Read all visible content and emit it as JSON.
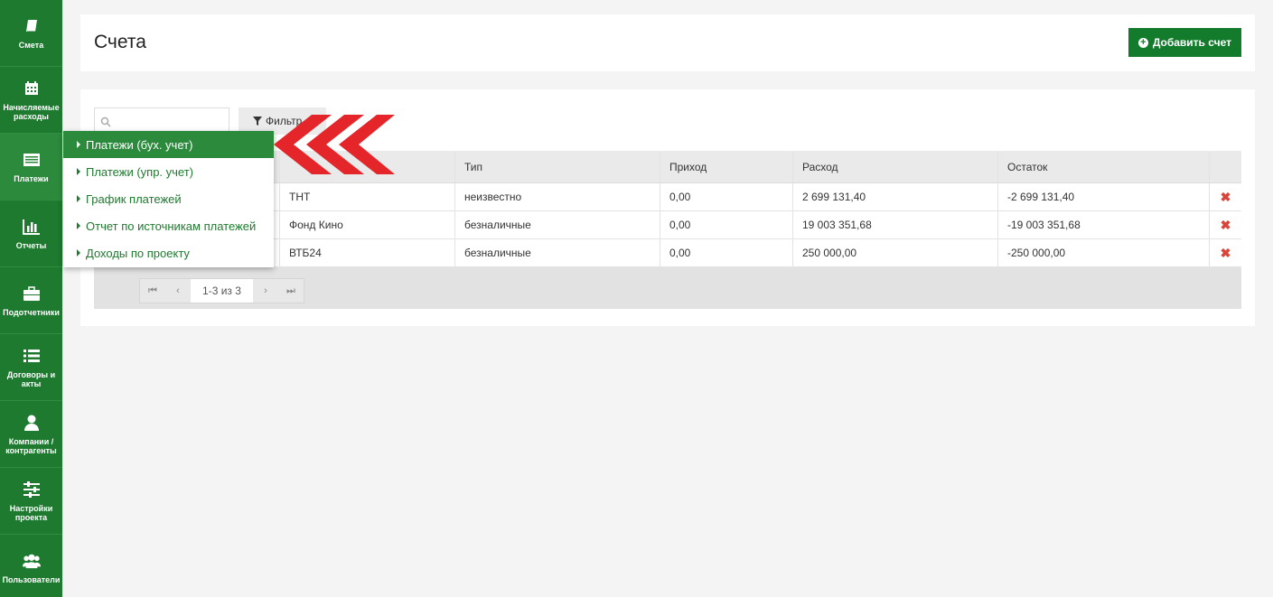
{
  "sidebar": {
    "items": [
      {
        "label": "Смета",
        "icon": "book-icon"
      },
      {
        "label": "Начисляемые расходы",
        "icon": "calendar-icon"
      },
      {
        "label": "Платежи",
        "icon": "list-card-icon"
      },
      {
        "label": "Отчеты",
        "icon": "bar-chart-icon"
      },
      {
        "label": "Подотчетники",
        "icon": "briefcase-icon"
      },
      {
        "label": "Договоры и акты",
        "icon": "list-icon"
      },
      {
        "label": "Компании / контрагенты",
        "icon": "user-icon"
      },
      {
        "label": "Настройки проекта",
        "icon": "sliders-icon"
      },
      {
        "label": "Пользователи",
        "icon": "users-icon"
      }
    ]
  },
  "header": {
    "title": "Счета",
    "add_button": "Добавить счет"
  },
  "toolbar": {
    "search_placeholder": "",
    "filter_label": "Фильтр"
  },
  "table": {
    "columns": [
      "",
      "",
      "Тип",
      "Приход",
      "Расход",
      "Остаток",
      ""
    ],
    "rows": [
      {
        "name": "ТНТ",
        "type": "неизвестно",
        "income": "0,00",
        "expense": "2 699 131,40",
        "balance": "-2 699 131,40"
      },
      {
        "name": "Фонд Кино",
        "type": "безналичные",
        "income": "0,00",
        "expense": "19 003 351,68",
        "balance": "-19 003 351,68"
      },
      {
        "name": "ВТБ24",
        "type": "безналичные",
        "income": "0,00",
        "expense": "250 000,00",
        "balance": "-250 000,00"
      }
    ]
  },
  "pager": {
    "info": "1-3 из 3"
  },
  "dropdown": {
    "items": [
      "Платежи (бух. учет)",
      "Платежи (упр. учет)",
      "График платежей",
      "Отчет по источникам платежей",
      "Доходы по проекту"
    ]
  },
  "colors": {
    "sidebar": "#1d7a2f",
    "accent": "#137c2c",
    "delete": "#d9443a",
    "annotation_arrow": "#e4252a"
  }
}
